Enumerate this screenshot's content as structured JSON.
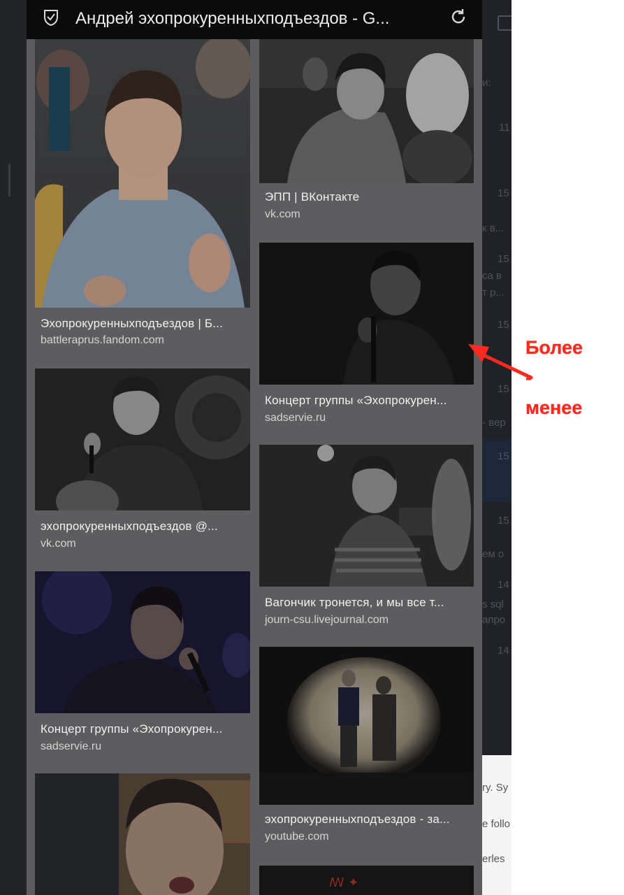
{
  "browser": {
    "title": "Андрей эхопрокуренныхподъездов - G...",
    "icons": {
      "left": "shield-check-icon",
      "right": "reload-icon"
    }
  },
  "results": {
    "left": [
      {
        "caption": "Эхопрокуренныхподъездов | Б...",
        "domain": "battleraprus.fandom.com"
      },
      {
        "caption": "эхопрокуренныхподъездов @...",
        "domain": "vk.com"
      },
      {
        "caption": "Концерт группы «Эхопрокурен...",
        "domain": "sadservie.ru"
      }
    ],
    "right": [
      {
        "caption": "ЭПП | ВКонтакте",
        "domain": "vk.com"
      },
      {
        "caption": "Концерт группы «Эхопрокурен...",
        "domain": "sadservie.ru"
      },
      {
        "caption": "Вагончик тронется, и мы все т...",
        "domain": "journ-csu.livejournal.com"
      },
      {
        "caption": "эхопрокуренныхподъездов - за...",
        "domain": "youtube.com"
      }
    ]
  },
  "annotation": {
    "line1": "Более",
    "line2": "-",
    "line3": "менее",
    "color": "#ff2a1f"
  }
}
